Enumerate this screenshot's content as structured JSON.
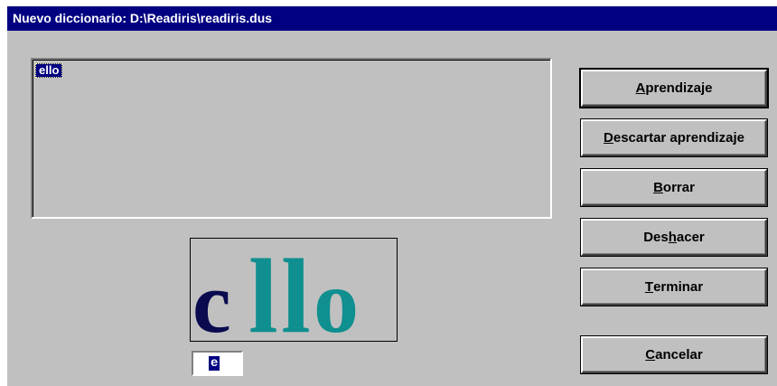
{
  "window": {
    "title": "Nuevo diccionario: D:\\Readiris\\readiris.dus"
  },
  "list": {
    "items": [
      "ello"
    ]
  },
  "buttons": {
    "aprendizaje": {
      "pre": "",
      "key": "A",
      "post": "prendizaje"
    },
    "descartar": {
      "pre": "",
      "key": "D",
      "post": "escartar aprendizaje"
    },
    "borrar": {
      "pre": "",
      "key": "B",
      "post": "orrar"
    },
    "deshacer": {
      "pre": "Des",
      "key": "h",
      "post": "acer"
    },
    "terminar": {
      "pre": "",
      "key": "T",
      "post": "erminar"
    },
    "cancelar": {
      "pre": "",
      "key": "C",
      "post": "ancelar"
    }
  },
  "preview": {
    "letters": [
      "c",
      "l",
      "l",
      "o"
    ],
    "colors": {
      "recognized": "#0a0a50",
      "unrecognized": "#0f8f8f"
    }
  },
  "char_input": {
    "value": "e"
  }
}
